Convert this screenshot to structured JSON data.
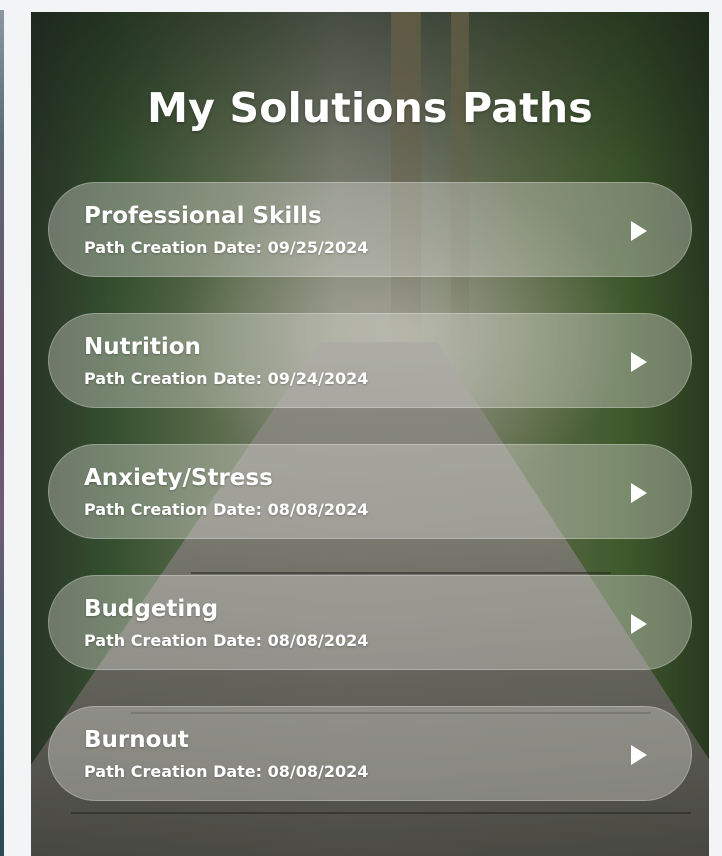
{
  "page": {
    "title": "My Solutions Paths"
  },
  "paths": [
    {
      "name": "Professional Skills",
      "date_label": "Path Creation Date: 09/25/2024"
    },
    {
      "name": "Nutrition",
      "date_label": "Path Creation Date: 09/24/2024"
    },
    {
      "name": "Anxiety/Stress",
      "date_label": "Path Creation Date: 08/08/2024"
    },
    {
      "name": "Budgeting",
      "date_label": "Path Creation Date: 08/08/2024"
    },
    {
      "name": "Burnout",
      "date_label": "Path Creation Date: 08/08/2024"
    }
  ],
  "icons": {
    "path_arrow": "play-triangle-icon"
  },
  "colors": {
    "text": "#ffffff",
    "page_bg": "#f3f4f6",
    "pill_bg": "rgba(220,222,215,0.38)"
  }
}
